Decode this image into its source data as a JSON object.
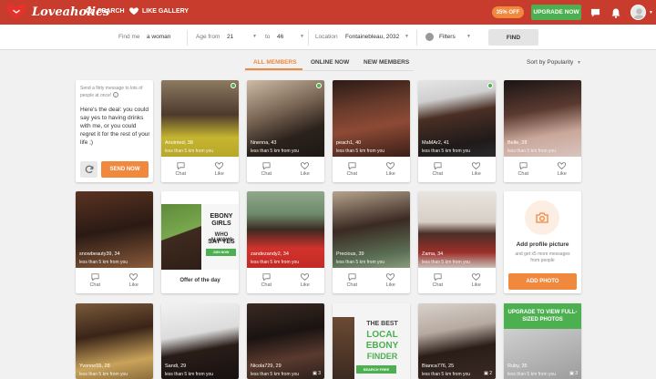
{
  "header": {
    "brand": "Loveaholics",
    "nav": [
      {
        "label": "SEARCH",
        "icon": "search-icon"
      },
      {
        "label": "LIKE GALLERY",
        "icon": "heart-icon"
      }
    ],
    "discount_badge": "35% OFF",
    "upgrade_label": "UPGRADE NOW",
    "icons": [
      "chat-icon",
      "bell-icon",
      "avatar",
      "chevron-down-icon"
    ],
    "colors": {
      "bar": "#c73c2c",
      "accent": "#f0883e",
      "green": "#4caf50"
    }
  },
  "search": {
    "find_me_label": "Find me",
    "find_me_value": "a woman",
    "age_from_label": "Age from",
    "age_from_value": "21",
    "age_to_label": "to",
    "age_to_value": "46",
    "location_label": "Location",
    "location_value": "Fontainebleau, 2032",
    "filters_label": "Filters",
    "find_button": "FIND"
  },
  "tabs": [
    {
      "label": "ALL MEMBERS",
      "active": true
    },
    {
      "label": "ONLINE NOW",
      "active": false
    },
    {
      "label": "NEW MEMBERS",
      "active": false
    }
  ],
  "sort_label": "Sort by Popularity",
  "promo": {
    "hint": "Send a flirty message to lots of people at once!",
    "message": "Here's the deal: you could say yes to having drinks with me, or you could regret it for the rest of your life ;)",
    "send_label": "SEND NOW"
  },
  "actions": {
    "chat": "Chat",
    "like": "Like"
  },
  "members_row1": [
    {
      "name": "Anointed, 38",
      "distance": "less than 5 km from you",
      "online": true
    },
    {
      "name": "Nnenna, 43",
      "distance": "less than 5 km from you",
      "online": true
    },
    {
      "name": "peach1, 40",
      "distance": "less than 5 km from you",
      "online": false
    },
    {
      "name": "MaMAr2, 41",
      "distance": "less than 5 km from you",
      "online": true
    },
    {
      "name": "Belle, 28",
      "distance": "less than 5 km from you",
      "online": false
    }
  ],
  "members_row2": [
    {
      "name": "snowbeauty39, 34",
      "distance": "less than 5 km from you"
    },
    {
      "name": "zandezandy2, 34",
      "distance": "less than 5 km from you"
    },
    {
      "name": "Precious, 39",
      "distance": "less than 5 km from you"
    },
    {
      "name": "Zama, 34",
      "distance": "less than 5 km from you"
    }
  ],
  "members_row3": [
    {
      "name": "Yvonne55, 28",
      "distance": "less than 5 km from you"
    },
    {
      "name": "Sandi, 29",
      "distance": "less than 5 km from you"
    },
    {
      "name": "Nicola729, 29",
      "distance": "less than 5 km from you",
      "photos": "3"
    },
    {
      "name": "Bianca776, 25",
      "distance": "less than 5 km from you",
      "photos": "2"
    },
    {
      "name": "Ruby, 35",
      "distance": "less than 5 km from you",
      "photos": "3"
    }
  ],
  "offer": {
    "line1": "EBONY GIRLS",
    "line2": "WHO ALWAYS",
    "line3": "SAY YES",
    "button": "JOIN NOW",
    "title": "Offer of the day"
  },
  "add_photo": {
    "title": "Add profile picture",
    "subtitle": "and get x5 more messages from people",
    "button": "ADD PHOTO"
  },
  "ebony_ad": {
    "line1": "THE BEST",
    "line2": "LOCAL",
    "line3": "EBONY",
    "line4": "FINDER",
    "button": "SEARCH FREE"
  },
  "upgrade_card": {
    "text": "UPGRADE TO VIEW FULL-SIZED PHOTOS"
  }
}
